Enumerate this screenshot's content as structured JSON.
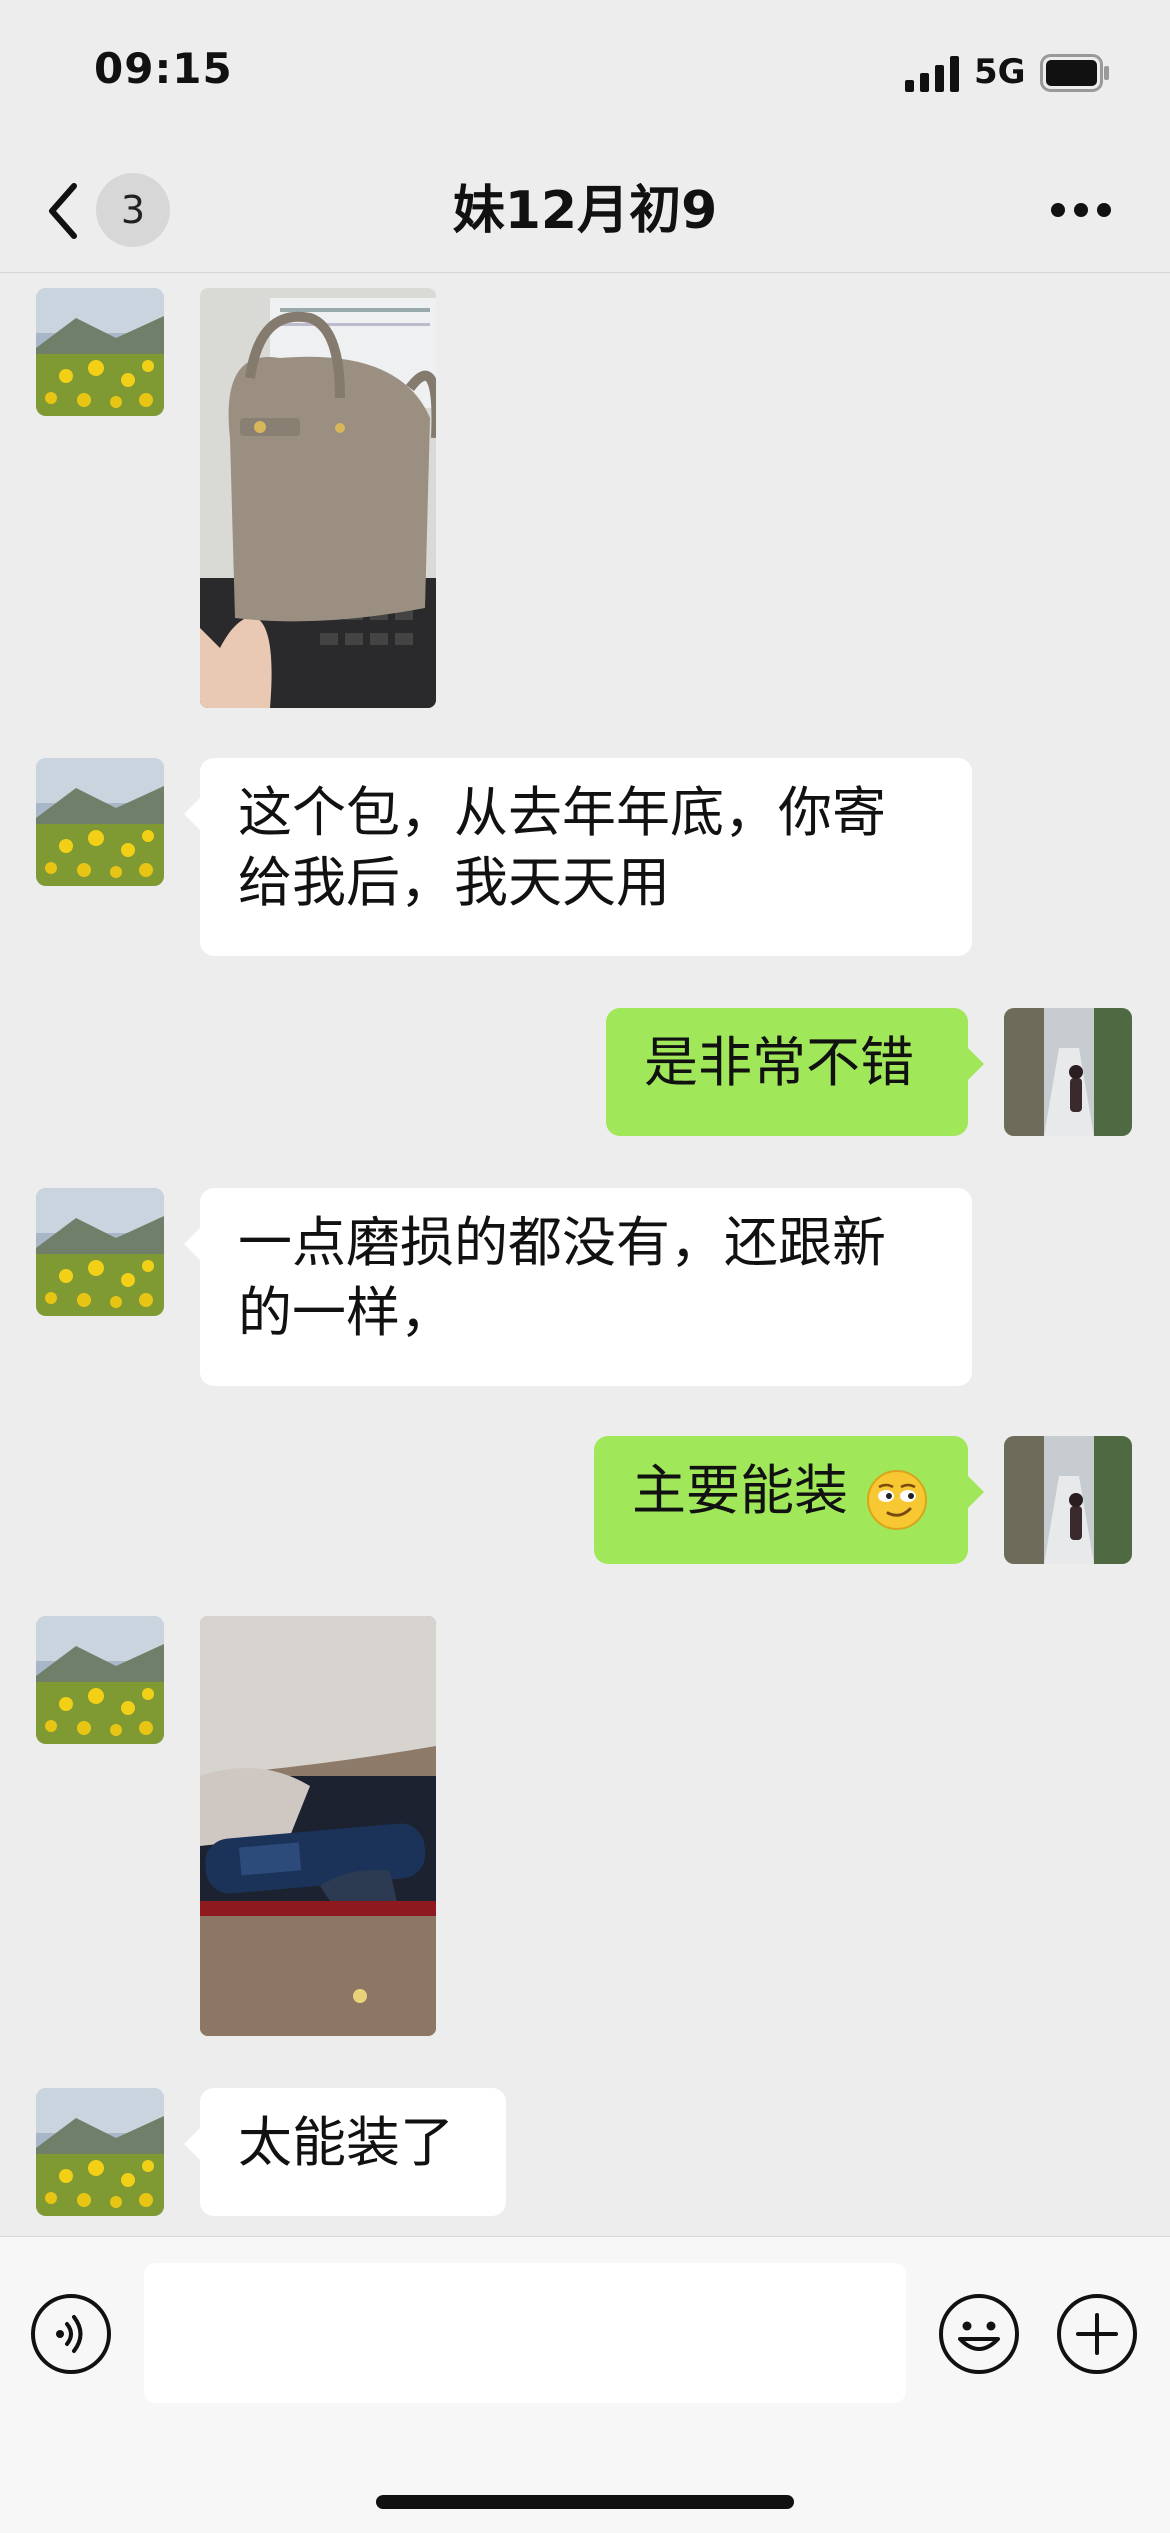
{
  "status_bar": {
    "time": "09:15",
    "network": "5G"
  },
  "nav": {
    "back_badge": "3",
    "title": "妹12月初9"
  },
  "messages": [
    {
      "type": "image",
      "side": "left",
      "image": "handbag-photo"
    },
    {
      "type": "text",
      "side": "left",
      "text_lines": [
        "这个包，从去年年底，你寄",
        "给我后，我天天用"
      ]
    },
    {
      "type": "text",
      "side": "right",
      "text": "是非常不错"
    },
    {
      "type": "text",
      "side": "left",
      "text_lines": [
        "一点磨损的都没有，还跟新",
        "的一样，"
      ]
    },
    {
      "type": "text",
      "side": "right",
      "text": "主要能装",
      "emoji": "smirk-emoji"
    },
    {
      "type": "image",
      "side": "left",
      "image": "bag-contents-photo"
    },
    {
      "type": "text",
      "side": "left",
      "text": "太能装了"
    }
  ],
  "input_bar": {
    "value": "",
    "icons": [
      "voice-icon",
      "emoji-icon",
      "plus-icon"
    ]
  },
  "colors": {
    "background": "#ededed",
    "bubble_self": "#a0e75a",
    "bubble_other": "#ffffff"
  }
}
